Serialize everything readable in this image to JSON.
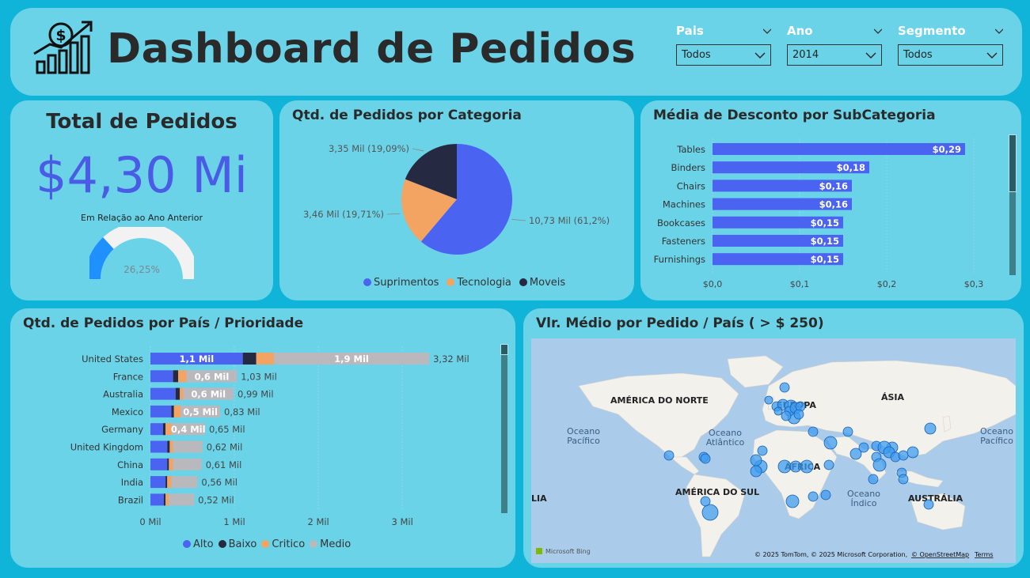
{
  "header": {
    "title": "Dashboard de Pedidos",
    "filters": [
      {
        "label": "Pais",
        "value": "Todos"
      },
      {
        "label": "Ano",
        "value": "2014"
      },
      {
        "label": "Segmento",
        "value": "Todos"
      }
    ]
  },
  "kpi": {
    "title": "Total de Pedidos",
    "value": "$4,30 Mi",
    "subtitle": "Em Relação ao Ano Anterior",
    "gauge_label": "26,25%",
    "gauge_fraction": 0.2625,
    "gauge_color": "#1e90ff"
  },
  "pie_panel": {
    "title": "Qtd. de Pedidos por Categoria"
  },
  "bar_panel": {
    "title": "Média de Desconto por SubCategoria"
  },
  "country_panel": {
    "title": "Qtd. de Pedidos por País / Prioridade"
  },
  "map_panel": {
    "title": "Vlr. Médio por Pedido / País ( > $ 250)",
    "labels": [
      {
        "id": "na",
        "text": "AMÉRICA DO NORTE"
      },
      {
        "id": "eu",
        "text": "EUROPA"
      },
      {
        "id": "as",
        "text": "ÁSIA"
      },
      {
        "id": "af",
        "text": "ÁFRICA"
      },
      {
        "id": "sa",
        "text": "AMÉRICA DO SUL"
      },
      {
        "id": "au",
        "text": "AUSTRÁLIA"
      },
      {
        "id": "ia",
        "text": "LIA"
      }
    ],
    "oceans": [
      {
        "id": "op1",
        "line1": "Oceano",
        "line2": "Pacífico"
      },
      {
        "id": "oa",
        "line1": "Oceano",
        "line2": "Atlântico"
      },
      {
        "id": "oi",
        "line1": "Oceano",
        "line2": "Índico"
      },
      {
        "id": "op2",
        "line1": "Oceano",
        "line2": "Pacífico"
      }
    ],
    "bing": "Microsoft Bing",
    "copyright": "© 2025 TomTom, © 2025 Microsoft Corporation,",
    "osm": "© OpenStreetMap",
    "terms": "Terms",
    "bubble_color": "#3d9cf0"
  },
  "chart_data": [
    {
      "type": "pie",
      "title": "Qtd. de Pedidos por Categoria",
      "slices": [
        {
          "name": "Suprimentos",
          "value": 10.73,
          "label": "10,73 Mil (61,2%)",
          "color": "#4a63f0"
        },
        {
          "name": "Tecnologia",
          "value": 3.46,
          "label": "3,46 Mil (19,71%)",
          "color": "#f3a463"
        },
        {
          "name": "Moveis",
          "value": 3.35,
          "label": "3,35 Mil (19,09%)",
          "color": "#252a42"
        }
      ]
    },
    {
      "type": "bar",
      "orientation": "horizontal",
      "title": "Média de Desconto por SubCategoria",
      "categories": [
        "Tables",
        "Binders",
        "Chairs",
        "Machines",
        "Bookcases",
        "Fasteners",
        "Furnishings"
      ],
      "values": [
        0.29,
        0.18,
        0.16,
        0.16,
        0.15,
        0.15,
        0.15
      ],
      "data_labels": [
        "$0,29",
        "$0,18",
        "$0,16",
        "$0,16",
        "$0,15",
        "$0,15",
        "$0,15"
      ],
      "xlim": [
        0,
        0.3
      ],
      "xticks": [
        0,
        0.1,
        0.2,
        0.3
      ],
      "xtick_labels": [
        "$0,0",
        "$0,1",
        "$0,2",
        "$0,3"
      ],
      "color": "#4a63f0"
    },
    {
      "type": "bar",
      "orientation": "horizontal",
      "stacked": true,
      "title": "Qtd. de Pedidos por País / Prioridade",
      "categories": [
        "United States",
        "France",
        "Australia",
        "Mexico",
        "Germany",
        "United Kingdom",
        "China",
        "India",
        "Brazil"
      ],
      "totals": [
        3.32,
        1.03,
        0.99,
        0.83,
        0.65,
        0.62,
        0.61,
        0.56,
        0.52
      ],
      "total_labels": [
        "3,32 Mil",
        "1,03 Mil",
        "0,99 Mil",
        "0,83 Mil",
        "0,65 Mil",
        "0,62 Mil",
        "0,61 Mil",
        "0,56 Mil",
        "0,52 Mil"
      ],
      "series": [
        {
          "name": "Alto",
          "color": "#4a63f0",
          "values": [
            1.1,
            0.27,
            0.3,
            0.25,
            0.15,
            0.2,
            0.2,
            0.18,
            0.16
          ],
          "labels": [
            "1,1 Mil",
            "",
            "",
            "",
            "",
            "",
            "",
            "",
            ""
          ]
        },
        {
          "name": "Baixo",
          "color": "#252a42",
          "values": [
            0.16,
            0.06,
            0.05,
            0.03,
            0.03,
            0.03,
            0.02,
            0.02,
            0.02
          ],
          "labels": [
            "",
            "",
            "",
            "",
            "",
            "",
            "",
            "",
            ""
          ]
        },
        {
          "name": "Critico",
          "color": "#f3a463",
          "values": [
            0.21,
            0.1,
            0.04,
            0.08,
            0.07,
            0.04,
            0.05,
            0.05,
            0.04
          ],
          "labels": [
            "",
            "",
            "",
            "",
            "",
            "",
            "",
            "",
            ""
          ]
        },
        {
          "name": "Medio",
          "color": "#b9b9bd",
          "values": [
            1.85,
            0.6,
            0.6,
            0.47,
            0.4,
            0.35,
            0.34,
            0.31,
            0.3
          ],
          "labels": [
            "1,9 Mil",
            "0,6 Mil",
            "0,6 Mil",
            "0,5 Mil",
            "0,4 Mil",
            "",
            "",
            "",
            ""
          ]
        }
      ],
      "xlim": [
        0,
        3.3
      ],
      "xticks": [
        0,
        1,
        2,
        3
      ],
      "xtick_labels": [
        "0 Mil",
        "1 Mil",
        "2 Mil",
        "3 Mil"
      ]
    }
  ]
}
